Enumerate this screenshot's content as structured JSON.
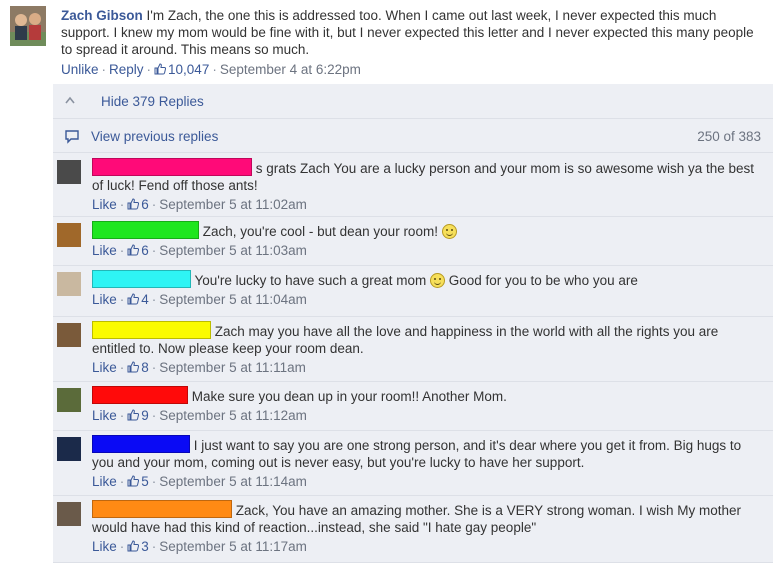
{
  "main_comment": {
    "author": "Zach Gibson",
    "text": "I'm Zach, the one this is addressed too. When I came out last week, I never expected this much support. I knew my mom would be fine with it, but I never expected this letter and I never expected this many people to spread it around. This means so much.",
    "unlike": "Unlike",
    "reply": "Reply",
    "likes": "10,047",
    "timestamp": "September 4 at 6:22pm"
  },
  "replies_panel": {
    "hide_label": "Hide 379 Replies",
    "view_previous": "View previous replies",
    "count": "250 of 383"
  },
  "icons": {
    "thumb": "thumbs-up-icon",
    "caret": "caret-up-icon",
    "comment": "comment-bubble-icon",
    "smiley": "smiley-icon"
  },
  "colors": {
    "link": "#3b5998",
    "panel_bg": "#edeff4"
  },
  "replies": [
    {
      "redact_color": "#ff0a78",
      "text_before": "",
      "text": "s grats Zach You are a lucky person and your mom is so awesome wish ya the best of luck! Fend off those ants!",
      "smiley": false,
      "text_after": "",
      "like": "Like",
      "likes": "6",
      "timestamp": "September 5 at 11:02am"
    },
    {
      "redact_color": "#1fe61f",
      "text": "Zach, you're cool - but dean your room!",
      "smiley": true,
      "text_after": "",
      "like": "Like",
      "likes": "6",
      "timestamp": "September 5 at 11:03am"
    },
    {
      "redact_color": "#2ef4f4",
      "text": "You're lucky to have such a great mom",
      "smiley": true,
      "text_after": "Good for you to be who you are",
      "like": "Like",
      "likes": "4",
      "timestamp": "September 5 at 11:04am"
    },
    {
      "redact_color": "#fbfb00",
      "text": "Zach may you have all the love and happiness in the world with all the rights you are entitled to. Now please keep your room dean.",
      "smiley": false,
      "text_after": "",
      "like": "Like",
      "likes": "8",
      "timestamp": "September 5 at 11:11am"
    },
    {
      "redact_color": "#ff0a0a",
      "text": "Make sure you dean up in your room!! Another Mom.",
      "smiley": false,
      "text_after": "",
      "like": "Like",
      "likes": "9",
      "timestamp": "September 5 at 11:12am"
    },
    {
      "redact_color": "#0a0af5",
      "text": "I just want to say you are one strong person, and it's dear where you get it from. Big hugs to you and your mom, coming out is never easy, but you're lucky to have her support.",
      "smiley": false,
      "text_after": "",
      "like": "Like",
      "likes": "5",
      "timestamp": "September 5 at 11:14am"
    },
    {
      "redact_color": "#ff8a14",
      "text": "Zack, You have an amazing mother. She is a VERY strong woman. I wish My mother would have had this kind of reaction...instead, she said \"I hate gay people\"",
      "smiley": false,
      "text_after": "",
      "like": "Like",
      "likes": "3",
      "timestamp": "September 5 at 11:17am"
    }
  ]
}
